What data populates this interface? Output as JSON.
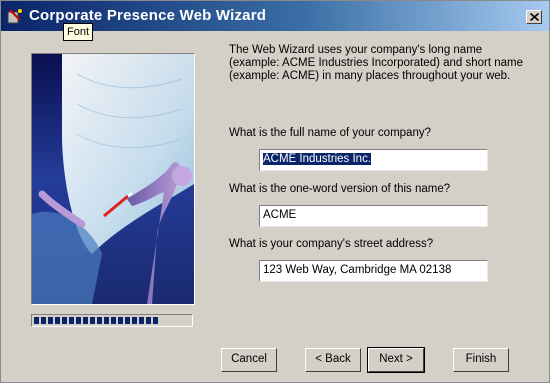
{
  "window": {
    "title": "Corporate Presence Web Wizard",
    "tooltip": "Font"
  },
  "intro": "The Web Wizard uses your company's long name (example: ACME Industries Incorporated) and short name (example: ACME) in many places throughout your web.",
  "questions": [
    {
      "label": "What is the full name of your company?",
      "value": "ACME Industries Inc."
    },
    {
      "label": "What is the one-word version of this name?",
      "value": "ACME"
    },
    {
      "label": "What is your company's street address?",
      "value": "123 Web Way, Cambridge MA 02138"
    }
  ],
  "progress": 0.8,
  "buttons": {
    "cancel": "Cancel",
    "back": "< Back",
    "next": "Next >",
    "finish": "Finish"
  },
  "icons": {
    "app": "wizard-app-icon",
    "close": "close-icon"
  }
}
